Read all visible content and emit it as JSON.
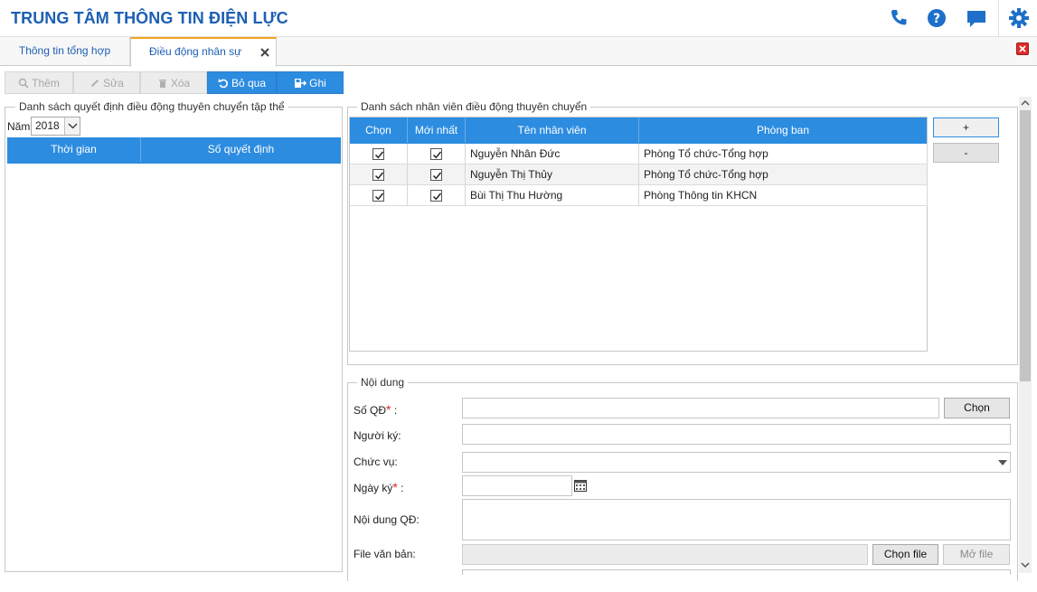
{
  "app": {
    "title": "TRUNG TÂM THÔNG TIN ĐIỆN LỰC"
  },
  "header_icons": [
    "phone-icon",
    "help-icon",
    "chat-icon",
    "settings-icon"
  ],
  "colors": {
    "brand_blue": "#1d5fb3",
    "accent_blue": "#2c8ce0",
    "tab_accent": "#f0a21b",
    "close_red": "#e02b2b"
  },
  "tabs": [
    {
      "label": "Thông tin tổng hợp",
      "active": false
    },
    {
      "label": "Điều động nhân sự",
      "active": true
    }
  ],
  "toolbar": {
    "add_label": "Thêm",
    "edit_label": "Sửa",
    "delete_label": "Xóa",
    "skip_label": "Bỏ qua",
    "save_label": "Ghi"
  },
  "left_panel": {
    "title": "Danh sách quyết định điều động thuyên chuyển tập thể",
    "year_label": "Năm",
    "year_value": "2018",
    "columns": [
      "Thời gian",
      "Số quyết định"
    ],
    "rows": []
  },
  "right_panel": {
    "title": "Danh sách nhân viên điều động thuyên chuyển",
    "columns": [
      "Chọn",
      "Mới nhất",
      "Tên nhân viên",
      "Phòng ban"
    ],
    "rows": [
      {
        "chon": true,
        "moi_nhat": true,
        "ten": "Nguyễn Nhân Đức",
        "phong_ban": "Phòng Tổ chức-Tổng hợp"
      },
      {
        "chon": true,
        "moi_nhat": true,
        "ten": "Nguyễn Thị Thủy",
        "phong_ban": "Phòng Tổ chức-Tổng hợp"
      },
      {
        "chon": true,
        "moi_nhat": true,
        "ten": "Bùi Thị Thu Hường",
        "phong_ban": "Phòng Thông tin KHCN"
      }
    ],
    "add_button": "+",
    "remove_button": "-"
  },
  "form": {
    "title": "Nội dung",
    "so_qd_label": "Số QĐ",
    "nguoi_ky_label": "Người ký:",
    "chuc_vu_label": "Chức vụ:",
    "ngay_ky_label": "Ngày ký",
    "noi_dung_label": "Nội dung QĐ:",
    "file_label": "File văn bản:",
    "required_mark": "*",
    "colon": ":",
    "choose_button": "Chọn",
    "choose_file_button": "Chọn file",
    "open_file_button": "Mở file",
    "so_qd_value": "",
    "nguoi_ky_value": "",
    "chuc_vu_value": "",
    "ngay_ky_value": "",
    "noi_dung_value": "",
    "file_value": ""
  }
}
